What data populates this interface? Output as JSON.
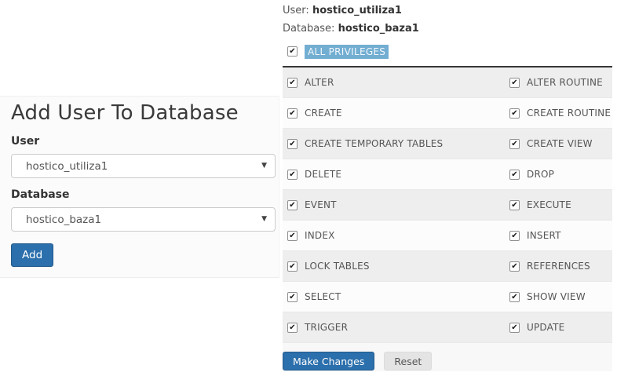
{
  "glyphs": {
    "dropdown_arrow": "▼",
    "check": "✔"
  },
  "colors": {
    "accent_blue": "#2b6fac",
    "selection_highlight": "#72aed2",
    "row_stripe": "#eeeeee",
    "dark_divider": "#383838"
  },
  "left_panel": {
    "title": "Add User To Database",
    "user_label": "User",
    "user_select_value": "hostico_utiliza1",
    "database_label": "Database",
    "database_select_value": "hostico_baza1",
    "add_button_label": "Add"
  },
  "right_panel": {
    "user_label": "User:",
    "user_value": "hostico_utiliza1",
    "database_label": "Database:",
    "database_value": "hostico_baza1",
    "all_privileges": {
      "label": "ALL PRIVILEGES",
      "checked": true
    },
    "privileges": [
      {
        "label": "ALTER",
        "checked": true
      },
      {
        "label": "ALTER ROUTINE",
        "checked": true
      },
      {
        "label": "CREATE",
        "checked": true
      },
      {
        "label": "CREATE ROUTINE",
        "checked": true
      },
      {
        "label": "CREATE TEMPORARY TABLES",
        "checked": true
      },
      {
        "label": "CREATE VIEW",
        "checked": true
      },
      {
        "label": "DELETE",
        "checked": true
      },
      {
        "label": "DROP",
        "checked": true
      },
      {
        "label": "EVENT",
        "checked": true
      },
      {
        "label": "EXECUTE",
        "checked": true
      },
      {
        "label": "INDEX",
        "checked": true
      },
      {
        "label": "INSERT",
        "checked": true
      },
      {
        "label": "LOCK TABLES",
        "checked": true
      },
      {
        "label": "REFERENCES",
        "checked": true
      },
      {
        "label": "SELECT",
        "checked": true
      },
      {
        "label": "SHOW VIEW",
        "checked": true
      },
      {
        "label": "TRIGGER",
        "checked": true
      },
      {
        "label": "UPDATE",
        "checked": true
      }
    ],
    "make_changes_label": "Make Changes",
    "reset_label": "Reset"
  }
}
